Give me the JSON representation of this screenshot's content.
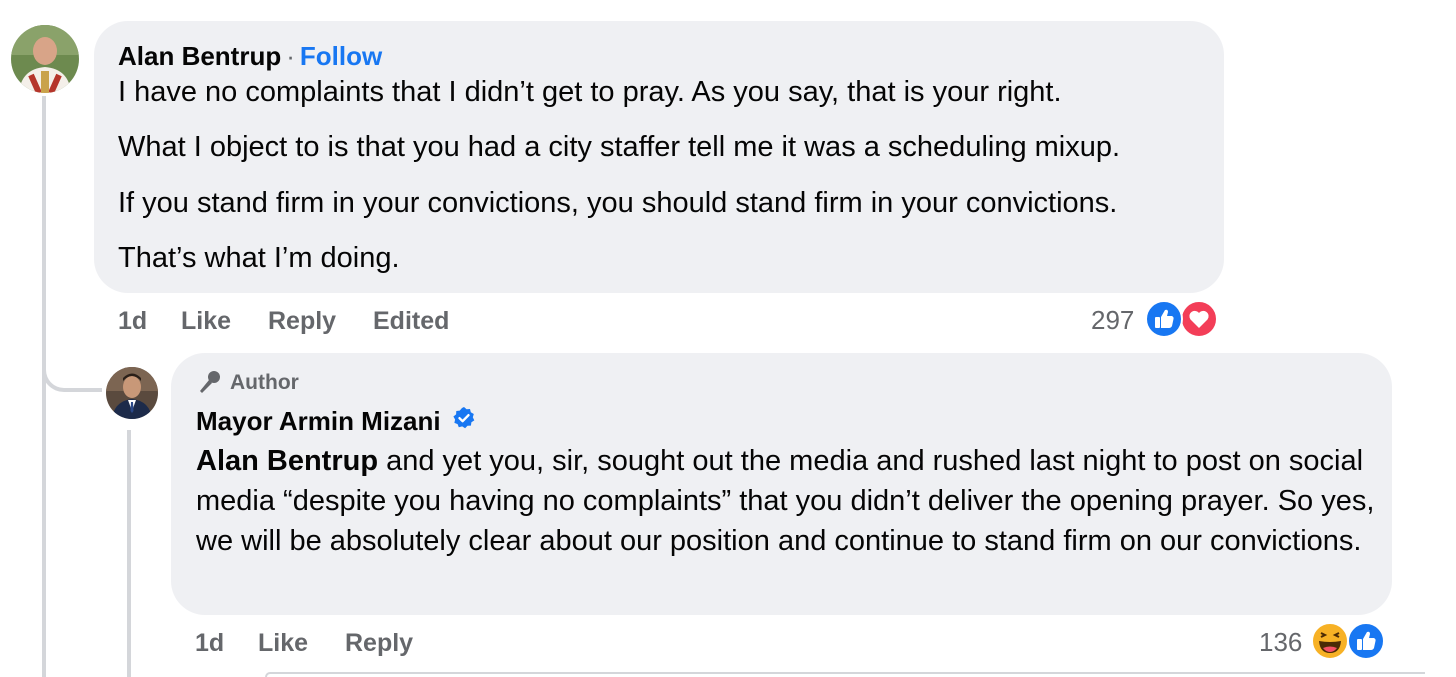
{
  "comment": {
    "author": "Alan Bentrup",
    "separator": "·",
    "follow_label": "Follow",
    "paragraphs": [
      "I have no complaints that I didn’t get to pray. As you say, that is your right.",
      "What I object to is that you had a city staffer tell me it was a scheduling mixup.",
      "If you stand firm in your convictions, you should stand firm in your convictions.",
      "That’s what I’m doing."
    ],
    "meta": {
      "time": "1d",
      "like": "Like",
      "reply": "Reply",
      "edited": "Edited"
    },
    "reaction_count": "297",
    "reactions": [
      "like-reaction-icon",
      "love-reaction-icon"
    ]
  },
  "reply": {
    "badge_label": "Author",
    "author": "Mayor Armin Mizani",
    "mention": "Alan Bentrup",
    "text": " and yet you, sir, sought out the media and rushed last night to post on social media “despite you having no complaints” that you didn’t deliver the opening prayer. So yes, we will be absolutely clear about our position and continue to stand firm on our convictions.",
    "meta": {
      "time": "1d",
      "like": "Like",
      "reply": "Reply"
    },
    "reaction_count": "136",
    "reactions": [
      "haha-reaction-icon",
      "like-reaction-icon"
    ]
  },
  "colors": {
    "bubble": "#eff0f3",
    "link": "#1877f2",
    "secondary_text": "#65676b",
    "love": "#f33e58",
    "haha": "#f7b125"
  }
}
